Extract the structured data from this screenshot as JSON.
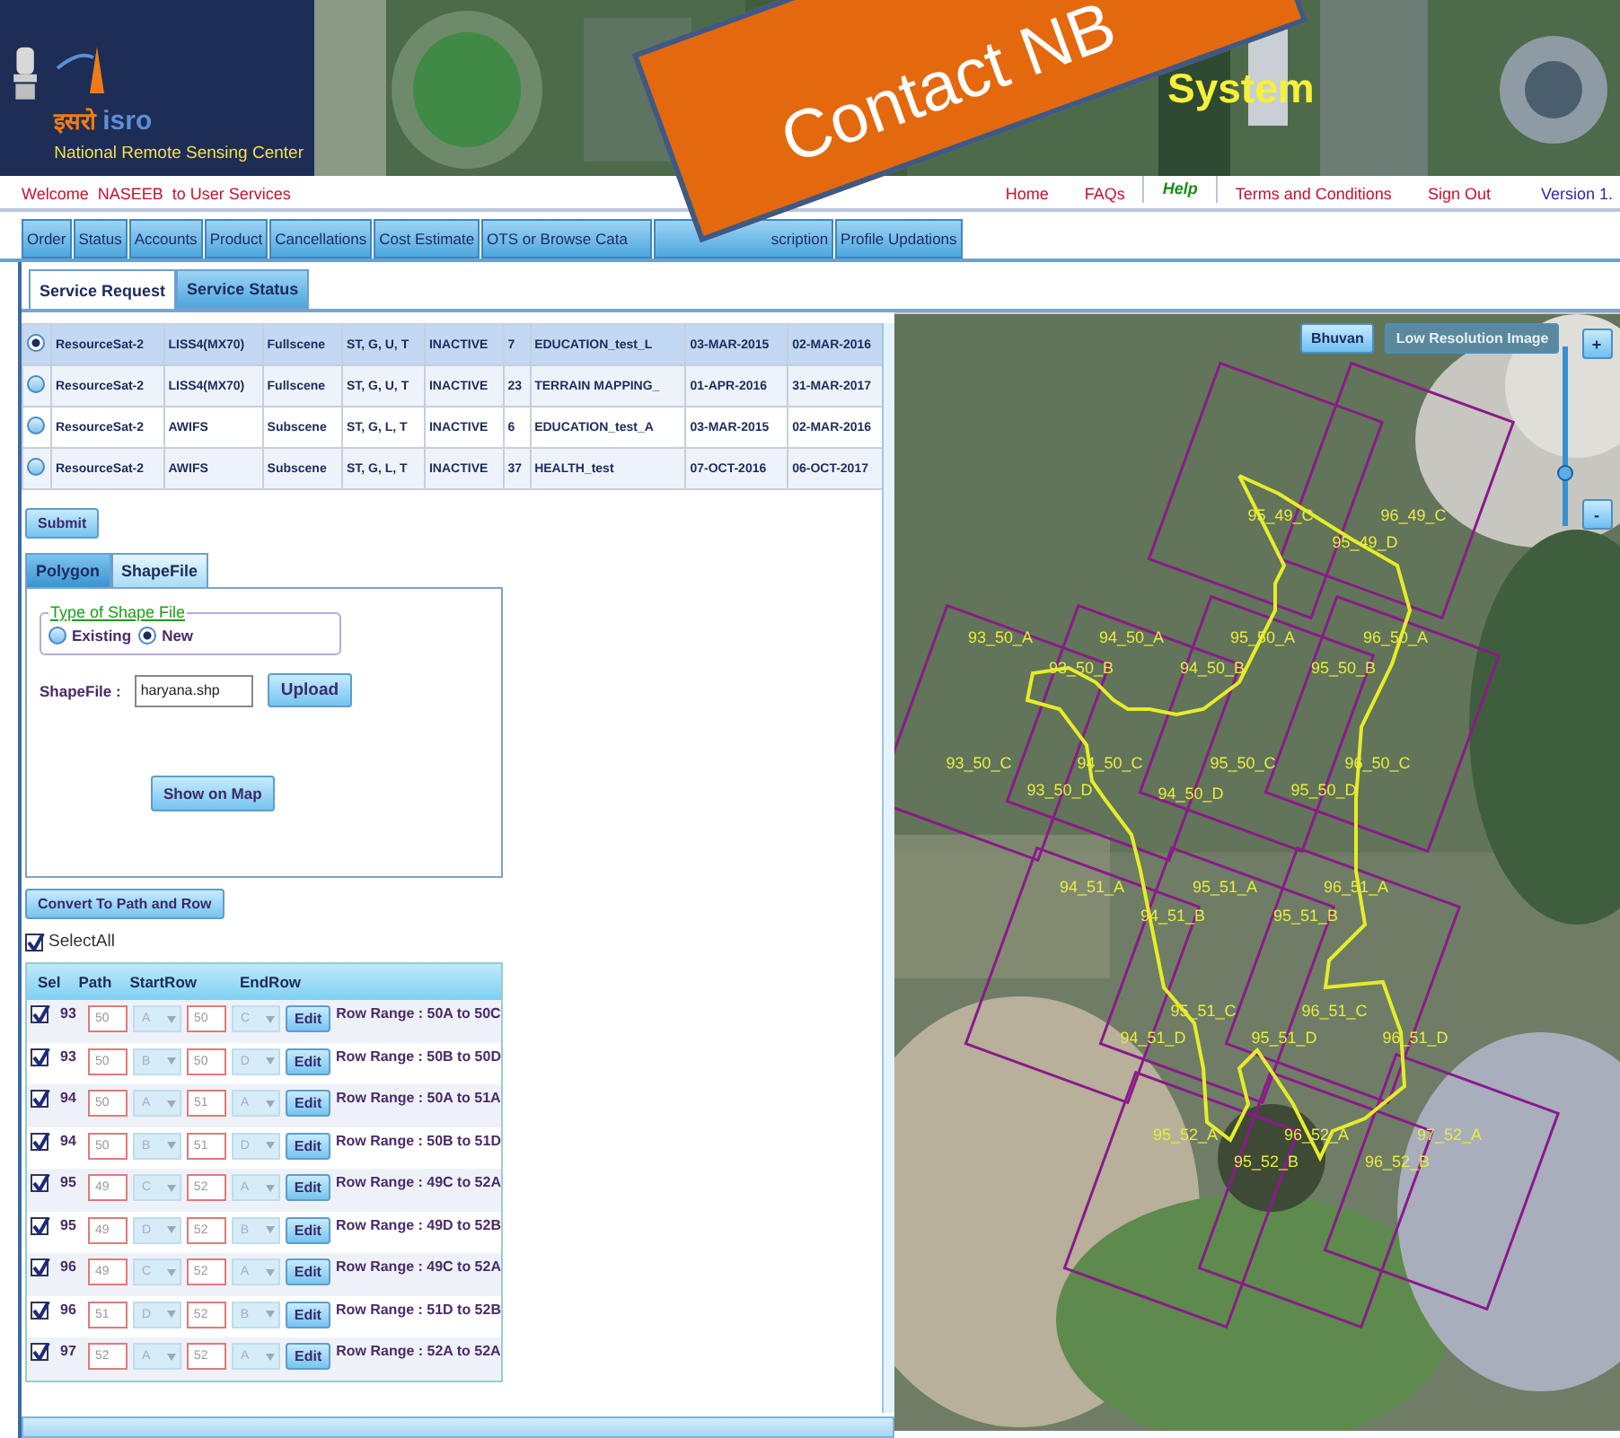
{
  "header": {
    "logo_hindi": "इसरो",
    "logo_latin": "isro",
    "org": "National Remote Sensing Center",
    "title": "System"
  },
  "callout": {
    "text": "Contact NB"
  },
  "welcome": "Welcome  NASEEB  to User Services",
  "top_links": [
    {
      "label": "Home",
      "selected": false
    },
    {
      "label": "FAQs",
      "selected": false
    },
    {
      "label": "Help",
      "selected": true
    },
    {
      "label": "Terms and Conditions",
      "selected": false
    },
    {
      "label": "Sign Out",
      "selected": false
    }
  ],
  "version": "Version 1.",
  "menu_tabs": [
    "Order",
    "Status",
    "Accounts",
    "Product",
    "Cancellations",
    "Cost Estimate",
    "OTS or Browse Cata",
    "scription",
    "Profile Updations"
  ],
  "sub_tabs": [
    {
      "label": "Service Request",
      "selected": true
    },
    {
      "label": "Service Status",
      "selected": false
    }
  ],
  "requests": [
    {
      "selected": true,
      "cells": [
        "ResourceSat-2",
        "LISS4(MX70)",
        "Fullscene",
        "ST, G, U, T",
        "INACTIVE",
        "7",
        "EDUCATION_test_L",
        "03-MAR-2015",
        "02-MAR-2016"
      ]
    },
    {
      "selected": false,
      "cells": [
        "ResourceSat-2",
        "LISS4(MX70)",
        "Fullscene",
        "ST, G, U, T",
        "INACTIVE",
        "23",
        "TERRAIN MAPPING_",
        "01-APR-2016",
        "31-MAR-2017"
      ]
    },
    {
      "selected": false,
      "cells": [
        "ResourceSat-2",
        "AWIFS",
        "Subscene",
        "ST, G, L, T",
        "INACTIVE",
        "6",
        "EDUCATION_test_A",
        "03-MAR-2015",
        "02-MAR-2016"
      ]
    },
    {
      "selected": false,
      "cells": [
        "ResourceSat-2",
        "AWIFS",
        "Subscene",
        "ST, G, L, T",
        "INACTIVE",
        "37",
        "HEALTH_test",
        "07-OCT-2016",
        "06-OCT-2017"
      ]
    }
  ],
  "submit": "Submit",
  "area_tabs": [
    {
      "label": "Polygon",
      "selected": false
    },
    {
      "label": "ShapeFile",
      "selected": true
    }
  ],
  "shape_type": {
    "legend": "Type of Shape File",
    "options": [
      {
        "label": "Existing",
        "selected": false
      },
      {
        "label": "New",
        "selected": true
      }
    ]
  },
  "shapefile": {
    "label": "ShapeFile :",
    "value": "haryana.shp",
    "upload": "Upload",
    "show": "Show on Map"
  },
  "convert": "Convert To Path and Row",
  "select_all": {
    "label": "SelectAll",
    "checked": true
  },
  "grid": {
    "columns": [
      "Sel",
      "Path",
      "StartRow",
      "EndRow"
    ],
    "rows": [
      {
        "checked": true,
        "path": "93",
        "start_row": "50",
        "start_quad": "A",
        "end_row": "50",
        "end_quad": "C",
        "edit": "Edit",
        "range": "Row Range : 50A to 50C"
      },
      {
        "checked": true,
        "path": "93",
        "start_row": "50",
        "start_quad": "B",
        "end_row": "50",
        "end_quad": "D",
        "edit": "Edit",
        "range": "Row Range : 50B to 50D"
      },
      {
        "checked": true,
        "path": "94",
        "start_row": "50",
        "start_quad": "A",
        "end_row": "51",
        "end_quad": "A",
        "edit": "Edit",
        "range": "Row Range : 50A to 51A"
      },
      {
        "checked": true,
        "path": "94",
        "start_row": "50",
        "start_quad": "B",
        "end_row": "51",
        "end_quad": "D",
        "edit": "Edit",
        "range": "Row Range : 50B to 51D"
      },
      {
        "checked": true,
        "path": "95",
        "start_row": "49",
        "start_quad": "C",
        "end_row": "52",
        "end_quad": "A",
        "edit": "Edit",
        "range": "Row Range : 49C to 52A"
      },
      {
        "checked": true,
        "path": "95",
        "start_row": "49",
        "start_quad": "D",
        "end_row": "52",
        "end_quad": "B",
        "edit": "Edit",
        "range": "Row Range : 49D to 52B"
      },
      {
        "checked": true,
        "path": "96",
        "start_row": "49",
        "start_quad": "C",
        "end_row": "52",
        "end_quad": "A",
        "edit": "Edit",
        "range": "Row Range : 49C to 52A"
      },
      {
        "checked": true,
        "path": "96",
        "start_row": "51",
        "start_quad": "D",
        "end_row": "52",
        "end_quad": "B",
        "edit": "Edit",
        "range": "Row Range : 51D to 52B"
      },
      {
        "checked": true,
        "path": "97",
        "start_row": "52",
        "start_quad": "A",
        "end_row": "52",
        "end_quad": "A",
        "edit": "Edit",
        "range": "Row Range : 52A to 52A"
      }
    ]
  },
  "map": {
    "buttons": [
      {
        "label": "Bhuvan",
        "disabled": false
      },
      {
        "label": "Low Resolution Image",
        "disabled": true
      }
    ],
    "zoom": {
      "plus": "+",
      "minus": "-",
      "level": 0.3
    },
    "tiles": [
      "95_49_C",
      "96_49_C",
      "95_49_D",
      "93_50_A",
      "94_50_A",
      "95_50_A",
      "96_50_A",
      "93_50_B",
      "94_50_B",
      "95_50_B",
      "93_50_C",
      "94_50_C",
      "95_50_C",
      "96_50_C",
      "93_50_D",
      "94_50_D",
      "95_50_D",
      "94_51_A",
      "95_51_A",
      "96_51_A",
      "94_51_B",
      "95_51_B",
      "95_51_C",
      "96_51_C",
      "94_51_D",
      "95_51_D",
      "96_51_D",
      "95_52_A",
      "96_52_A",
      "97_52_A",
      "95_52_B",
      "96_52_B"
    ]
  }
}
